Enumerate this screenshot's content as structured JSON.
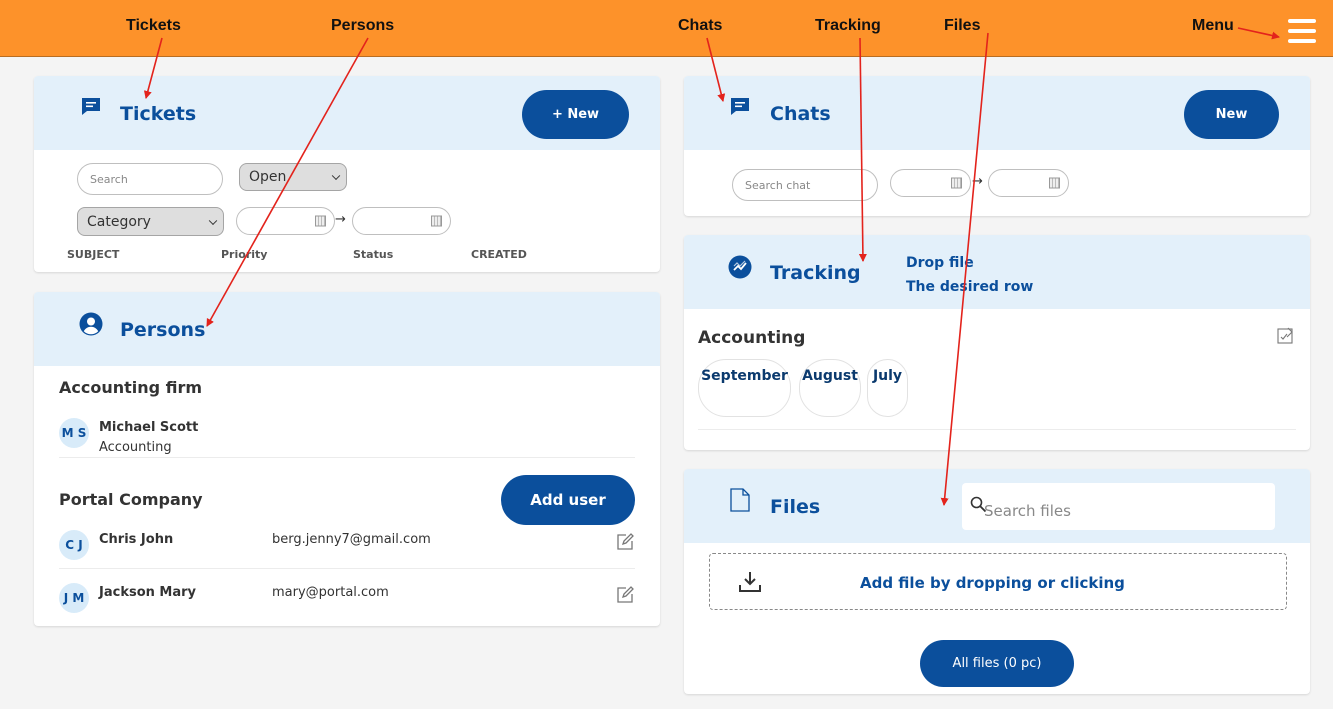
{
  "annotations": {
    "tickets": "Tickets",
    "persons": "Persons",
    "chats": "Chats",
    "tracking": "Tracking",
    "files": "Files",
    "menu": "Menu"
  },
  "colors": {
    "annotation_bar": "#fd922a",
    "card_header": "#e3f0fa",
    "brand_blue": "#0b4f9c",
    "arrow_red": "#e3231c"
  },
  "tickets": {
    "title": "Tickets",
    "new_button": "+ New",
    "search_placeholder": "Search",
    "status_select": "Open",
    "category_select": "Category",
    "columns": [
      "SUBJECT",
      "Priority",
      "Status",
      "CREATED"
    ]
  },
  "persons": {
    "title": "Persons",
    "groups": [
      {
        "name": "Accounting firm",
        "people": [
          {
            "initials": "M S",
            "name": "Michael Scott",
            "subtitle": "Accounting"
          }
        ]
      },
      {
        "name": "Portal Company",
        "add_button": "Add user",
        "people": [
          {
            "initials": "C J",
            "name": "Chris John",
            "email": "berg.jenny7@gmail.com"
          },
          {
            "initials": "J M",
            "name": "Jackson Mary",
            "email": "mary@portal.com"
          }
        ]
      }
    ]
  },
  "chats": {
    "title": "Chats",
    "new_button": "New",
    "search_placeholder": "Search chat"
  },
  "tracking": {
    "title": "Tracking",
    "hint_line1": "Drop file",
    "hint_line2": "The desired row",
    "row_title": "Accounting",
    "months": [
      "September",
      "August",
      "July"
    ]
  },
  "files": {
    "title": "Files",
    "search_placeholder": "Search files",
    "dropzone_text": "Add file by dropping or clicking",
    "all_files_button": "All files (0 pc)"
  }
}
